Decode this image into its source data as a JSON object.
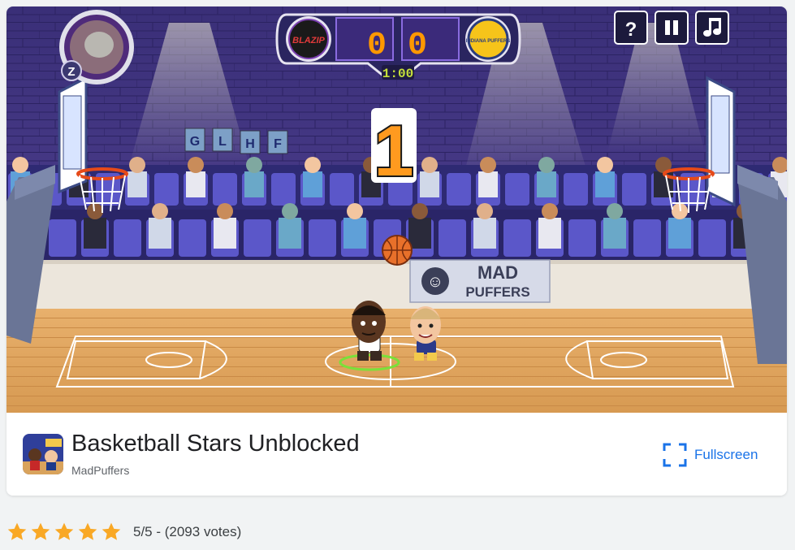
{
  "game": {
    "score_home": "0",
    "score_away": "0",
    "timer": "1:00",
    "countdown": "1",
    "team_home_logo": "BLAZIP",
    "team_away_logo": "INDIANA PUFFERS",
    "banner_line1": "MAD",
    "banner_line2": "PUFFERS",
    "crowd_signs": [
      "G",
      "L",
      "H",
      "F"
    ],
    "help_label": "?",
    "player_badge": "Z",
    "icons": {
      "help": "help-icon",
      "pause": "pause-icon",
      "music": "music-note-icon"
    }
  },
  "info": {
    "title": "Basketball Stars Unblocked",
    "publisher": "MadPuffers",
    "fullscreen_label": "Fullscreen"
  },
  "rating": {
    "stars": 5,
    "text": "5/5 - (2093 votes)"
  },
  "colors": {
    "accent": "#1a73e8",
    "star": "#f9a825",
    "score": "#ff9800",
    "timer": "#c6e03a"
  }
}
